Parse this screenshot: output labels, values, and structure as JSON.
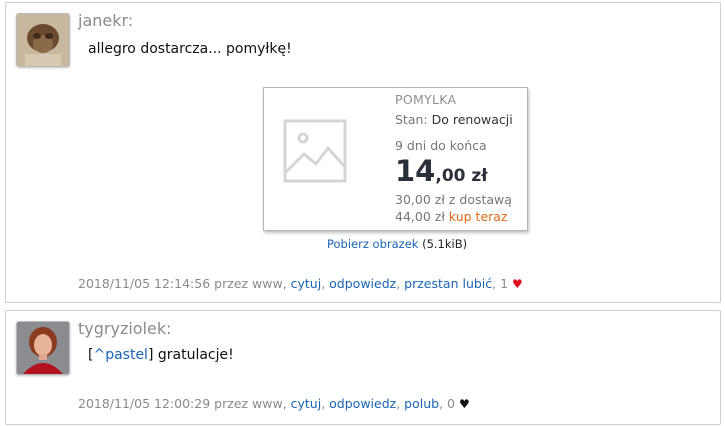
{
  "posts": [
    {
      "author": "janekr:",
      "message": "allegro dostarcza... pomyłkę!",
      "card": {
        "product_name": "POMYLKA",
        "state_label": "Stan:",
        "state_value": "Do renowacji",
        "days_left": "9 dni do końca",
        "price_main": "14",
        "price_rest": ",00 zł",
        "with_shipping": "30,00 zł z dostawą",
        "buy_now_price": "44,00 zł",
        "buy_now_label": "kup teraz"
      },
      "download": {
        "link": "Pobierz obrazek",
        "size": "(5.1kiB)"
      },
      "meta": {
        "date": "2018/11/05 12:14:56 przez www,",
        "quote": "cytuj",
        "reply": "odpowiedz",
        "like_action": "przestan lubić",
        "likes": "1",
        "heart_icon": "heart-icon",
        "heart_color": "#e0101e"
      }
    },
    {
      "author": "tygryziolek:",
      "mention_open": "[",
      "mention": "^pastel",
      "mention_close": "]",
      "message": "gratulacje!",
      "meta": {
        "date": "2018/11/05 12:00:29 przez www,",
        "quote": "cytuj",
        "reply": "odpowiedz",
        "like_action": "polub",
        "likes": "0",
        "heart_icon": "heart-icon",
        "heart_color": "#111111"
      }
    }
  ],
  "colors": {
    "link": "#1a64b4",
    "buy_now": "#e0691a",
    "muted": "#8a8a8a"
  }
}
